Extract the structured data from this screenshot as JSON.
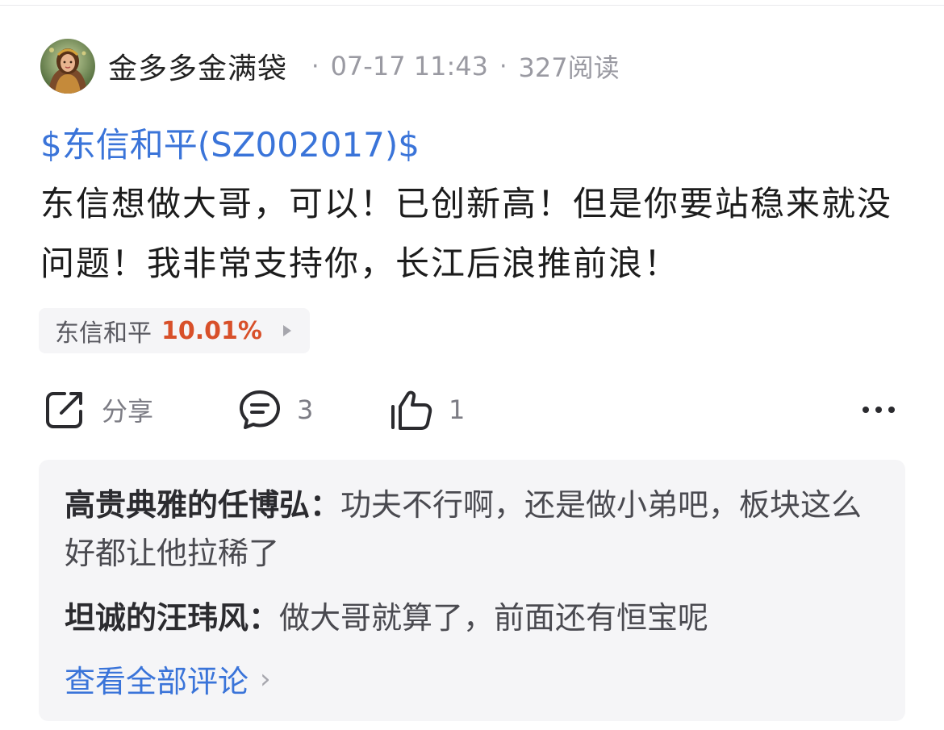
{
  "post": {
    "author": "金多多金满袋",
    "date": "07-17 11:43",
    "reads": "327阅读",
    "stock_tag": "$东信和平(SZ002017)$",
    "content": "东信想做大哥，可以！已创新高！但是你要站稳来就没问题！我非常支持你，长江后浪推前浪！"
  },
  "quote": {
    "name": "东信和平",
    "change": "10.01%",
    "change_color": "#d8502a"
  },
  "actions": {
    "share_label": "分享",
    "comment_count": "3",
    "like_count": "1",
    "icons": [
      "share-icon",
      "comment-icon",
      "thumbs-up-icon",
      "more-icon"
    ]
  },
  "comments": [
    {
      "user": "高贵典雅的任博弘：",
      "text": "功夫不行啊，还是做小弟吧，板块这么好都让他拉稀了"
    },
    {
      "user": "坦诚的汪玮风：",
      "text": "做大哥就算了，前面还有恒宝呢"
    }
  ],
  "view_all_label": "查看全部评论",
  "colors": {
    "link": "#3a74d9",
    "up": "#d8502a",
    "muted": "#9a9aa2",
    "panel": "#f5f5f7"
  }
}
